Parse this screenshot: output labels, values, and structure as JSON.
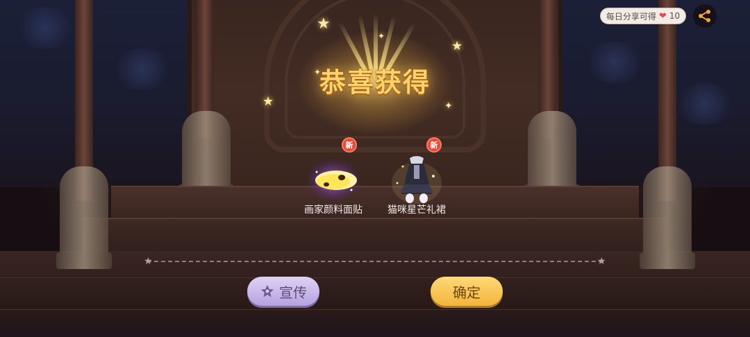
{
  "share": {
    "label": "每日分享可得",
    "reward_count": "10",
    "heart_icon": "heart-icon",
    "share_icon": "share-icon"
  },
  "title": "恭喜获得",
  "rewards": [
    {
      "name": "画家颜料面贴",
      "badge": "新",
      "icon": "paint-sticker-icon"
    },
    {
      "name": "猫咪星芒礼裙",
      "badge": "新",
      "icon": "cat-dress-icon"
    }
  ],
  "buttons": {
    "promote": "宣传",
    "confirm": "确定"
  },
  "colors": {
    "title": "#ffd36a",
    "promote_button": "#c8b8ea",
    "confirm_button": "#f7c654",
    "new_badge": "#e24a3a"
  }
}
